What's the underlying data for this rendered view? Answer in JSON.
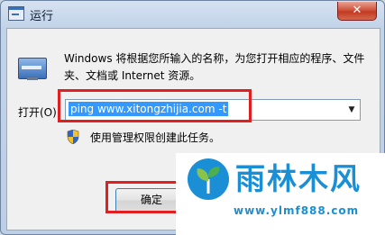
{
  "window": {
    "title": "运行",
    "close_label": "✕"
  },
  "content": {
    "description": "Windows 将根据您所输入的名称，为您打开相应的程序、文件夹、文档或 Internet 资源。",
    "open_label": "打开(O):",
    "command_value": "ping www.xitongzhijia.com -t",
    "admin_notice": "使用管理权限创建此任务。"
  },
  "buttons": {
    "ok_label": "确定"
  },
  "watermark": {
    "brand": "雨林木风",
    "url": "www.ylmf888.com"
  },
  "colors": {
    "highlight": "#e02020",
    "selection": "#3399ff",
    "brand": "#1a8fd5"
  },
  "icons": [
    "run-icon",
    "shield-icon",
    "chevron-down-icon",
    "close-icon",
    "app-icon",
    "logo-icon"
  ]
}
